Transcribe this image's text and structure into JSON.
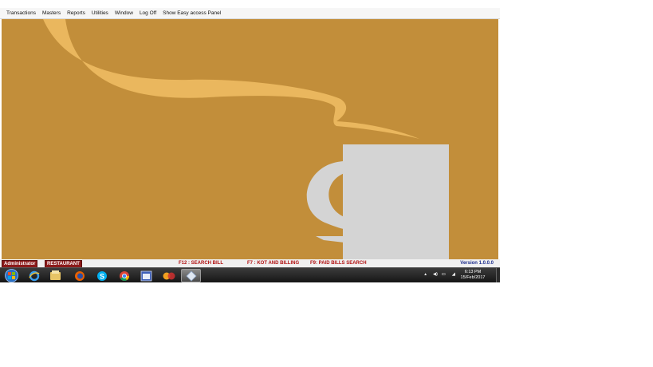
{
  "menu": {
    "items": [
      "Transactions",
      "Masters",
      "Reports",
      "Utilities",
      "Window",
      "Log Off",
      "Show Easy access Panel"
    ]
  },
  "colors": {
    "background": "#c28e3a",
    "steam": "#eab75e",
    "cup": "#d4d4d4",
    "badge": "#8b1a1a",
    "hint": "#b01010",
    "version": "#1a2b8c"
  },
  "status": {
    "user": "Administrator",
    "module": "RESTAURANT",
    "hint_f12": "F12 : SEARCH BILL",
    "hint_f7": "F7 : KOT AND BILLING",
    "hint_f9": "F9: PAID BILLS SEARCH",
    "version": "Version 1.0.0.0"
  },
  "taskbar": {
    "apps": [
      "windows-start-icon",
      "internet-explorer-icon",
      "file-explorer-icon",
      "firefox-icon",
      "skype-icon",
      "chrome-icon",
      "app-window-icon",
      "media-player-icon",
      "restaurant-app-icon"
    ],
    "time": "6:13 PM",
    "date": "15/Feb/2017"
  }
}
